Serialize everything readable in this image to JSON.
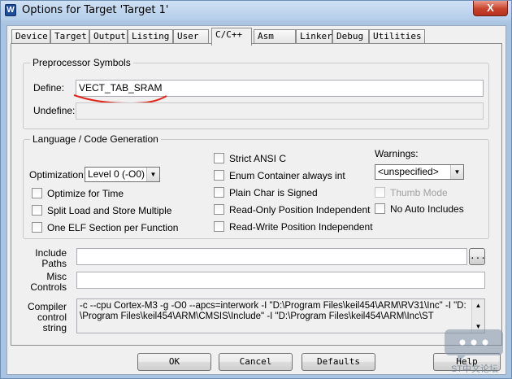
{
  "window": {
    "title": "Options for Target 'Target 1'",
    "app_icon": "W",
    "close_label": "X"
  },
  "tabs": [
    "Device",
    "Target",
    "Output",
    "Listing",
    "User",
    "C/C++",
    "Asm",
    "Linker",
    "Debug",
    "Utilities"
  ],
  "active_tab": "C/C++",
  "preprocessor": {
    "legend": "Preprocessor Symbols",
    "define_label": "Define:",
    "define_value": "VECT_TAB_SRAM",
    "undefine_label": "Undefine:",
    "undefine_value": ""
  },
  "language": {
    "legend": "Language / Code Generation",
    "optimization_label": "Optimization:",
    "optimization_value": "Level 0 (-O0)",
    "optimize_for_time": "Optimize for Time",
    "split_load_store": "Split Load and Store Multiple",
    "one_elf_section": "One ELF Section per Function",
    "strict_ansi": "Strict ANSI C",
    "enum_container": "Enum Container always int",
    "plain_char_signed": "Plain Char is Signed",
    "ro_position_independent": "Read-Only Position Independent",
    "rw_position_independent": "Read-Write Position Independent",
    "warnings_label": "Warnings:",
    "warnings_value": "<unspecified>",
    "thumb_mode": "Thumb Mode",
    "no_auto_includes": "No Auto Includes"
  },
  "paths": {
    "include_label_1": "Include",
    "include_label_2": "Paths",
    "include_value": "",
    "browse_label": "...",
    "misc_label_1": "Misc",
    "misc_label_2": "Controls",
    "misc_value": "",
    "compiler_label_1": "Compiler",
    "compiler_label_2": "control",
    "compiler_label_3": "string",
    "compiler_line_1": "-c --cpu Cortex-M3 -g -O0 --apcs=interwork -I \"D:\\Program Files\\keil454\\ARM\\RV31\\Inc\" -I \"D:",
    "compiler_line_2": "\\Program Files\\keil454\\ARM\\CMSIS\\Include\" -I \"D:\\Program Files\\keil454\\ARM\\Inc\\ST"
  },
  "buttons": {
    "ok": "OK",
    "cancel": "Cancel",
    "defaults": "Defaults",
    "help": "Help"
  },
  "watermark": {
    "text": "ST中文论坛"
  },
  "colors": {
    "annotation_red": "#e0261a",
    "close_red": "#c8432b"
  }
}
